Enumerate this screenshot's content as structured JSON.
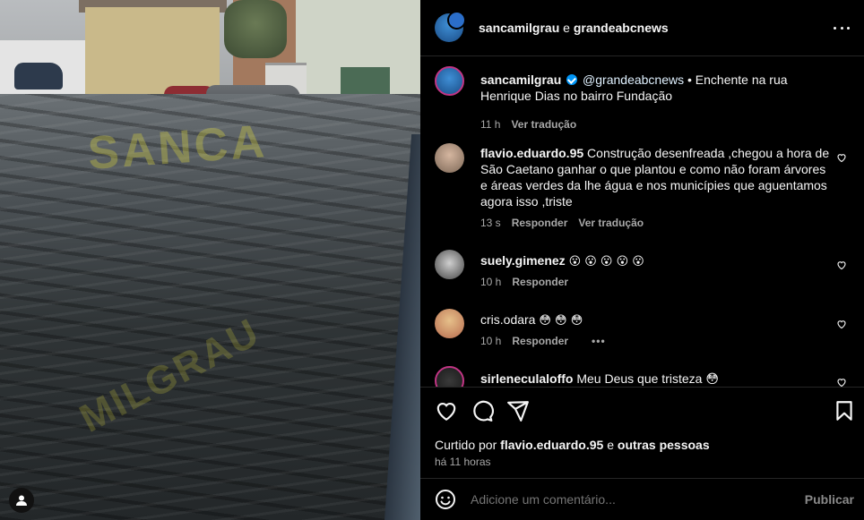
{
  "media": {
    "watermark_top": "SANCA",
    "watermark_bottom": "MILGRAU"
  },
  "header": {
    "user1": "sancamilgrau",
    "conjunction": "e",
    "user2": "grandeabcnews"
  },
  "caption": {
    "username": "sancamilgrau",
    "mention": "@grandeabcnews",
    "text": "• Enchente na rua Henrique Dias no bairro Fundação",
    "age": "11 h",
    "translate": "Ver tradução"
  },
  "comments": [
    {
      "username": "flavio.eduardo.95",
      "text": "Construção desenfreada ,chegou a hora de São Caetano ganhar o que plantou e como não foram árvores e áreas verdes da lhe água e nos municípies que aguentamos agora isso ,triste",
      "age": "13 s",
      "reply": "Responder",
      "translate": "Ver tradução"
    },
    {
      "username": "suely.gimenez",
      "text": "😮 😮 😮 😮 😮",
      "age": "10 h",
      "reply": "Responder"
    },
    {
      "username": "cris.odara",
      "text": "😳 😳 😳",
      "age": "10 h",
      "reply": "Responder",
      "more": "•••"
    },
    {
      "username": "sirleneculaloffo",
      "text": "Meu Deus que tristeza 😳"
    }
  ],
  "likes": {
    "prefix": "Curtido por",
    "user": "flavio.eduardo.95",
    "conjunction": "e",
    "others": "outras pessoas"
  },
  "post_time": "há 11 horas",
  "add_comment": {
    "placeholder": "Adicione um comentário...",
    "post_label": "Publicar"
  },
  "colors": {
    "background": "#000000",
    "secondary_text": "#a8a8a8",
    "verified": "#0095f6",
    "divider": "#262626"
  },
  "icons": [
    "more-icon",
    "verified-icon",
    "heart-icon",
    "comment-icon",
    "share-icon",
    "bookmark-icon",
    "emoji-icon",
    "user-tag-icon"
  ]
}
